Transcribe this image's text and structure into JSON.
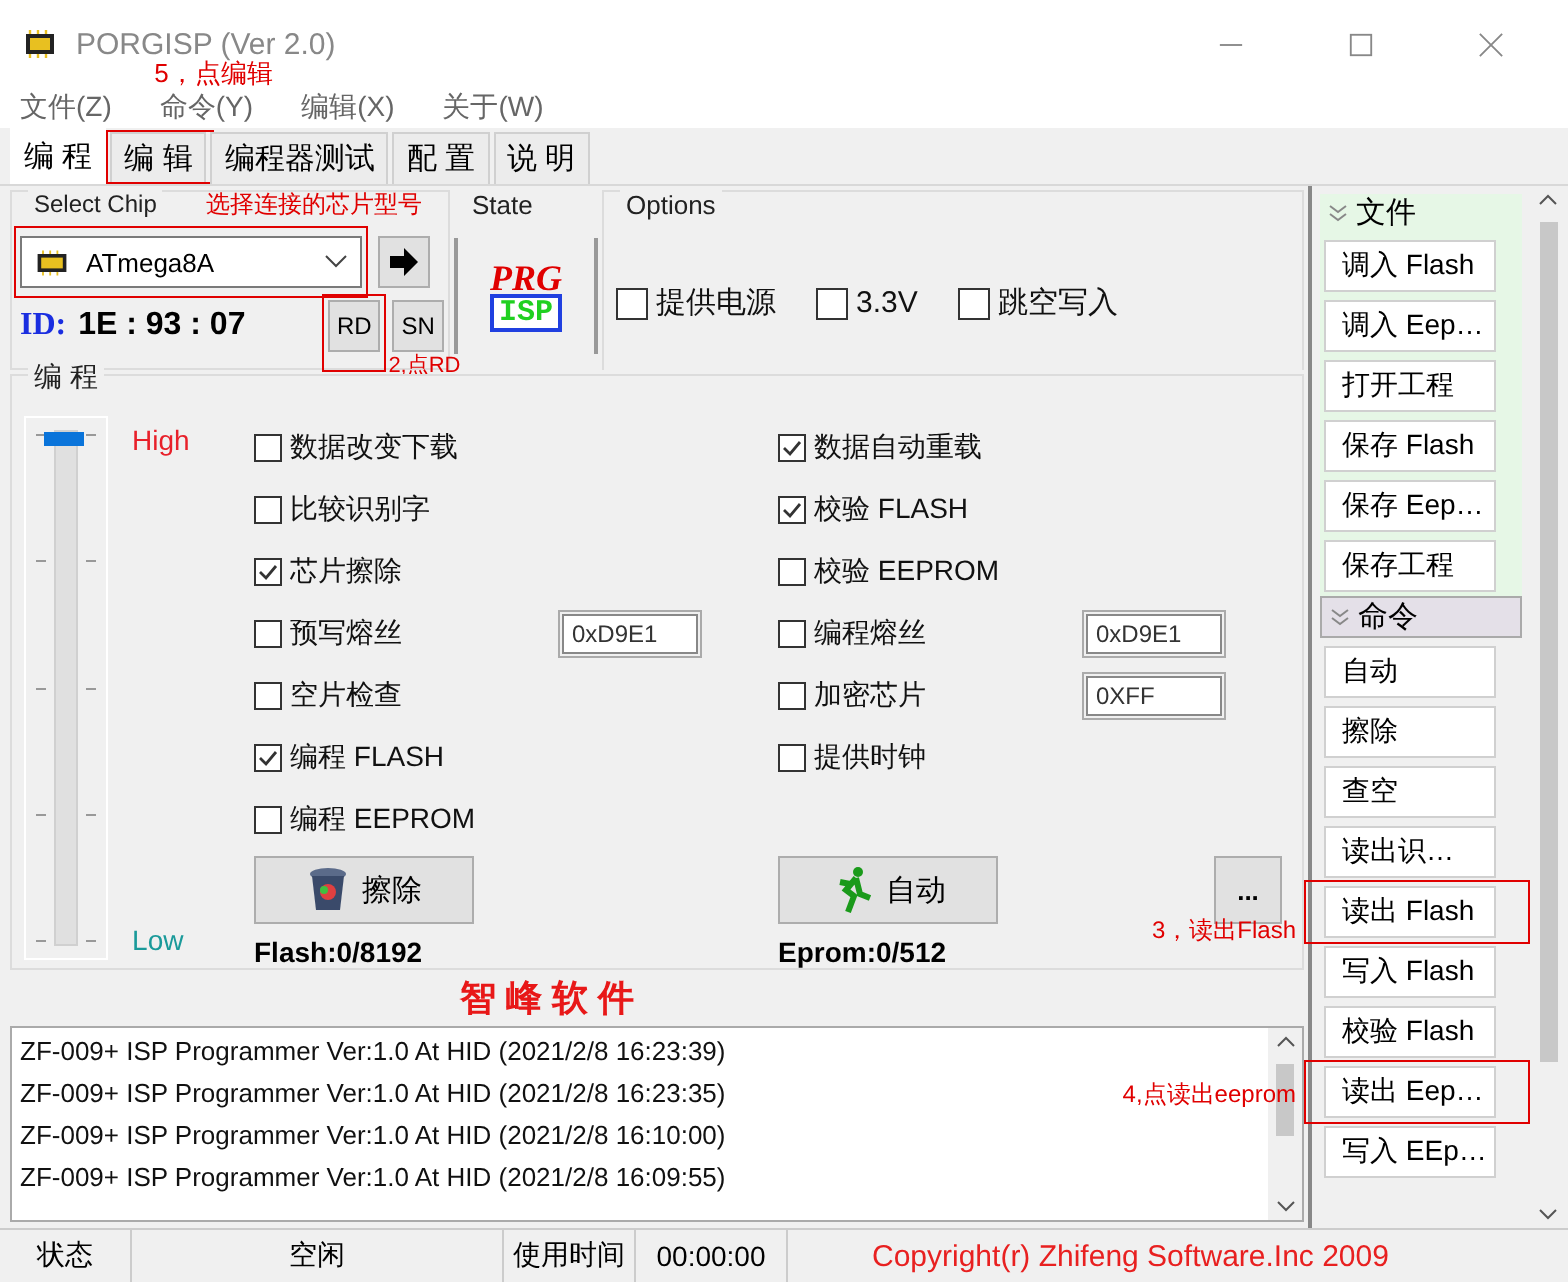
{
  "window": {
    "title": "PORGISP (Ver 2.0)"
  },
  "menu": [
    "文件(Z)",
    "命令(Y)",
    "编辑(X)",
    "关于(W)"
  ],
  "tabs": [
    {
      "label": "编 程",
      "selected": true
    },
    {
      "label": "编 辑",
      "selected": false,
      "annotation": "5，点编辑"
    },
    {
      "label": "编程器测试",
      "selected": false
    },
    {
      "label": "配 置",
      "selected": false
    },
    {
      "label": "说 明",
      "selected": false
    }
  ],
  "select_chip": {
    "title": "Select Chip",
    "chip": "ATmega8A",
    "annotation": "选择连接的芯片型号",
    "id_label": "ID:",
    "id_value": "1E : 93 : 07",
    "rd_button": "RD",
    "rd_annotation": "2,点RD",
    "sn_button": "SN"
  },
  "state": {
    "title": "State",
    "logo_top": "PRG",
    "logo_bottom": "ISP"
  },
  "options": {
    "title": "Options",
    "items": [
      {
        "label": "提供电源",
        "checked": false
      },
      {
        "label": "3.3V",
        "checked": false
      },
      {
        "label": "跳空写入",
        "checked": false
      }
    ]
  },
  "programming": {
    "title": "编 程",
    "slider": {
      "level": 1,
      "high": "High",
      "low": "Low"
    },
    "left": [
      {
        "label": "数据改变下载",
        "checked": false
      },
      {
        "label": "比较识别字",
        "checked": false
      },
      {
        "label": "芯片擦除",
        "checked": true
      },
      {
        "label": "预写熔丝",
        "checked": false,
        "field": "0xD9E1"
      },
      {
        "label": "空片检查",
        "checked": false
      },
      {
        "label": "编程 FLASH",
        "checked": true
      },
      {
        "label": "编程 EEPROM",
        "checked": false
      }
    ],
    "right": [
      {
        "label": "数据自动重载",
        "checked": true
      },
      {
        "label": "校验 FLASH",
        "checked": true
      },
      {
        "label": "校验 EEPROM",
        "checked": false
      },
      {
        "label": "编程熔丝",
        "checked": false,
        "field": "0xD9E1"
      },
      {
        "label": "加密芯片",
        "checked": false,
        "field": "0XFF"
      },
      {
        "label": "提供时钟",
        "checked": false
      }
    ],
    "erase_button": "擦除",
    "auto_button": "自动",
    "more_button": "...",
    "flash_count": "Flash:0/8192",
    "eprom_count": "Eprom:0/512"
  },
  "brand": "智 峰 软 件",
  "log": [
    "ZF-009+ ISP Programmer Ver:1.0 At HID (2021/2/8 16:23:39)",
    "ZF-009+ ISP Programmer Ver:1.0 At HID (2021/2/8 16:23:35)",
    "ZF-009+ ISP Programmer Ver:1.0 At HID (2021/2/8 16:10:00)",
    "ZF-009+ ISP Programmer Ver:1.0 At HID (2021/2/8 16:09:55)"
  ],
  "sidebar": [
    {
      "title": "文件",
      "highlighted": true,
      "buttons": [
        {
          "label": "调入 Flash"
        },
        {
          "label": "调入 Eep…"
        },
        {
          "label": "打开工程"
        },
        {
          "label": "保存 Flash"
        },
        {
          "label": "保存 Eep…"
        },
        {
          "label": "保存工程"
        }
      ]
    },
    {
      "title": "命令",
      "highlighted": false,
      "buttons": [
        {
          "label": "自动"
        },
        {
          "label": "擦除"
        },
        {
          "label": "查空"
        },
        {
          "label": "读出识…"
        },
        {
          "label": "读出 Flash",
          "annotation": "3，读出Flash"
        },
        {
          "label": "写入 Flash"
        },
        {
          "label": "校验 Flash"
        },
        {
          "label": "读出 Eep…",
          "annotation": "4,点读出eeprom"
        },
        {
          "label": "写入 EEp…"
        }
      ]
    }
  ],
  "status_bar": {
    "cells": [
      "状态",
      "空闲",
      "使用时间",
      "00:00:00"
    ],
    "copyright": "Copyright(r) Zhifeng Software.Inc 2009"
  }
}
